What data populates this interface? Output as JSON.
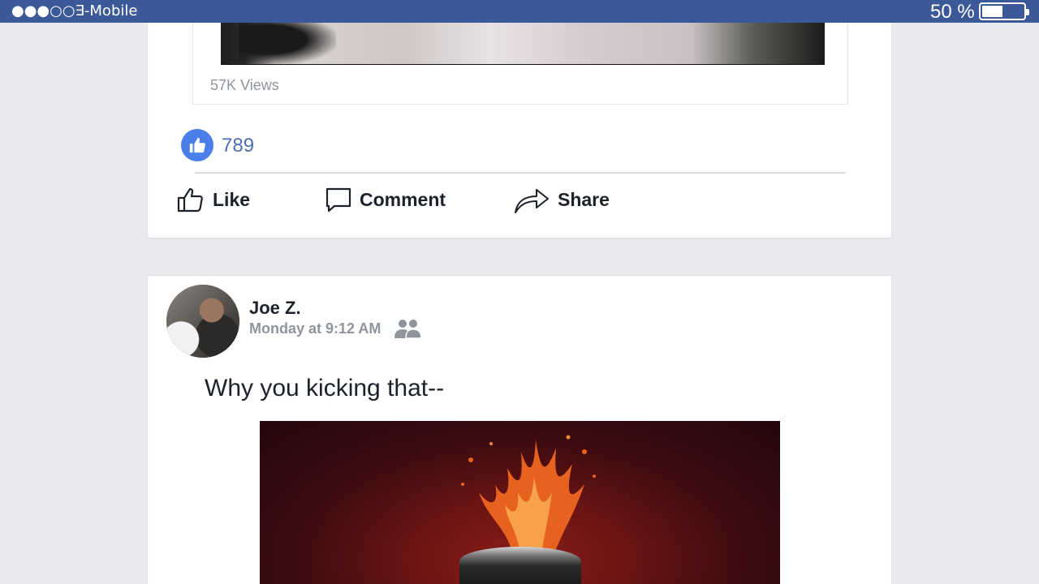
{
  "status_bar": {
    "signal": "●●●○○",
    "carrier": "∃-Mobile",
    "battery_percent": "50 %",
    "battery_level": 0.5
  },
  "post1": {
    "views": "57K Views",
    "reaction_count": "789",
    "actions": {
      "like": "Like",
      "comment": "Comment",
      "share": "Share"
    }
  },
  "post2": {
    "author": "Joe Z.",
    "timestamp": "Monday at 9:12 AM",
    "text": "Why you kicking that--"
  },
  "colors": {
    "status_bar_bg": "#3b5998",
    "like_blue": "#4a7ee8",
    "page_bg": "#e9eaed"
  }
}
